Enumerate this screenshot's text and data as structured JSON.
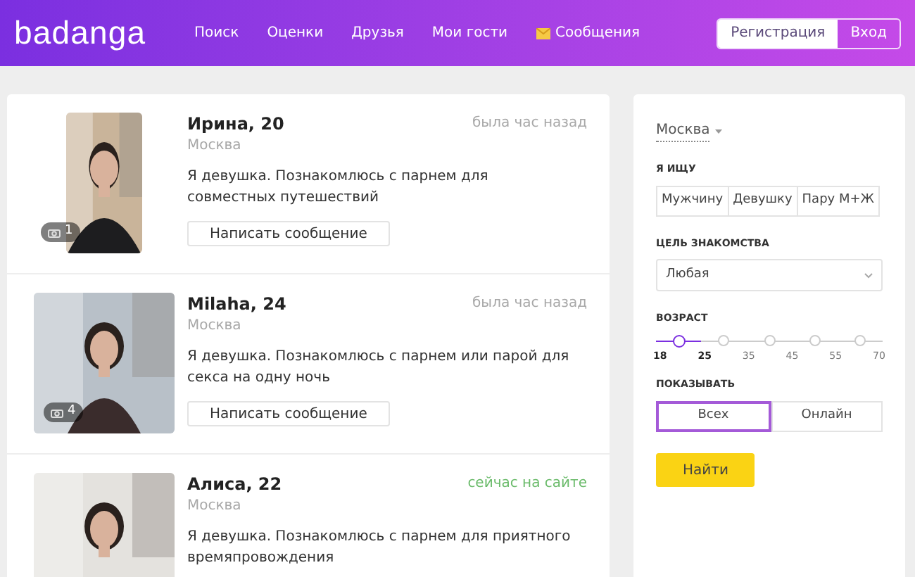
{
  "header": {
    "logo": "badanga",
    "nav": [
      {
        "label": "Поиск",
        "kind": "link"
      },
      {
        "label": "Оценки",
        "kind": "link"
      },
      {
        "label": "Друзья",
        "kind": "link"
      },
      {
        "label": "Мои гости",
        "kind": "link"
      },
      {
        "label": "Сообщения",
        "kind": "mail"
      }
    ],
    "auth": [
      {
        "label": "Регистрация",
        "selected": true
      },
      {
        "label": "Вход",
        "selected": false
      }
    ]
  },
  "profiles": [
    {
      "name": "Ирина, 20",
      "city": "Москва",
      "status": "была час назад",
      "online": false,
      "about": "Я девушка. Познакомлюсь с парнем для совместных путешествий",
      "photo_count": "1",
      "photo": {
        "kind": "picture",
        "portrait": true
      },
      "button": "Написать сообщение"
    },
    {
      "name": "Milaha, 24",
      "city": "Москва",
      "status": "была час назад",
      "online": false,
      "about": "Я девушка. Познакомлюсь с парнем или парой для секса на одну ночь",
      "photo_count": "4",
      "photo": {
        "kind": "picture",
        "portrait": false
      },
      "button": "Написать сообщение"
    },
    {
      "name": "Алиса, 22",
      "city": "Москва",
      "status": "сейчас на сайте",
      "online": true,
      "about": "Я девушка. Познакомлюсь с парнем для приятного времяпровождения",
      "photo": {
        "kind": "picture",
        "portrait": false
      }
    }
  ],
  "filter": {
    "city": "Москва",
    "looking_for": {
      "label": "Я ИЩУ",
      "options": [
        {
          "label": "Мужчину",
          "selected": false
        },
        {
          "label": "Девушку",
          "selected": false
        },
        {
          "label": "Пару М+Ж",
          "selected": false
        }
      ]
    },
    "goal": {
      "label": "ЦЕЛЬ ЗНАКОМСТВА",
      "value": "Любая"
    },
    "age": {
      "label": "ВОЗРАСТ",
      "level": 0.1,
      "ticks": [
        {
          "label": "18",
          "selected": true
        },
        {
          "label": "25",
          "selected": true
        },
        {
          "label": "35",
          "selected": false
        },
        {
          "label": "45",
          "selected": false
        },
        {
          "label": "55",
          "selected": false
        },
        {
          "label": "70",
          "selected": false
        }
      ]
    },
    "show": {
      "label": "ПОКАЗЫВАТЬ",
      "options": [
        {
          "label": "Всех",
          "selected": true
        },
        {
          "label": "Онлайн",
          "selected": false
        }
      ]
    },
    "submit": "Найти"
  }
}
